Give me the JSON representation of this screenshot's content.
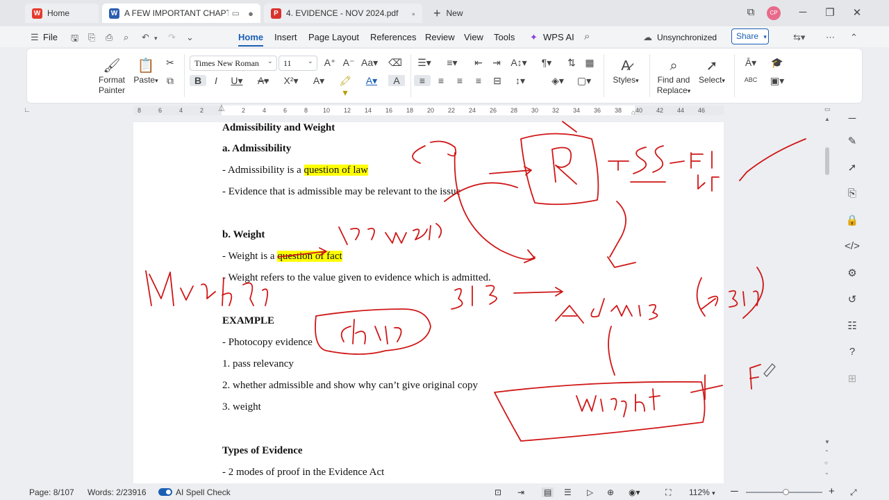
{
  "tabs": [
    {
      "label": "Home",
      "icon": "wps-logo-icon",
      "color": "#e63a2e"
    },
    {
      "label": "A FEW IMPORTANT CHAPTER",
      "icon": "word-doc-icon",
      "color": "#2a5db0"
    },
    {
      "label": "4. EVIDENCE - NOV 2024.pdf",
      "icon": "pdf-icon",
      "color": "#d9322b"
    }
  ],
  "new_tab_label": "New",
  "avatar_initials": "CP",
  "menu": {
    "file": "File",
    "items": [
      "Home",
      "Insert",
      "Page Layout",
      "References",
      "Review",
      "View",
      "Tools"
    ],
    "wps_ai": "WPS AI",
    "sync": "Unsynchronized",
    "share": "Share"
  },
  "ribbon": {
    "format_painter_1": "Format",
    "format_painter_2": "Painter",
    "paste": "Paste",
    "font_name": "Times New Roman",
    "font_size": "11",
    "styles": "Styles",
    "find_1": "Find and",
    "find_2": "Replace",
    "select": "Select"
  },
  "ruler_labels": [
    "8",
    "6",
    "4",
    "2",
    "2",
    "4",
    "6",
    "8",
    "10",
    "12",
    "14",
    "16",
    "18",
    "20",
    "22",
    "24",
    "26",
    "28",
    "30",
    "32",
    "34",
    "36",
    "38",
    "40",
    "42",
    "44",
    "46"
  ],
  "document": {
    "h1": "Admissibility and Weight",
    "a_title": "a. Admissibility",
    "a1_pre": "- Admissibility is a ",
    "a1_hl": "question of law",
    "a2": "- Evidence that is admissible may be relevant to the issue",
    "b_title": "b. Weight",
    "b1_pre": "- Weight is a ",
    "b1_hl": "question of fact",
    "b2": "- Weight refers to the value given to evidence which is admitted.",
    "example": "EXAMPLE",
    "e1": "- Photocopy evidence",
    "e2": "1. pass relevancy",
    "e3": "2. whether admissible and show why can’t give original copy",
    "e4": "3. weight",
    "types": "Types of Evidence",
    "t1": "- 2 modes of proof in the Evidence Act"
  },
  "status": {
    "page": "Page: 8/107",
    "words": "Words: 2/23916",
    "spell": "AI Spell Check",
    "zoom": "112%"
  },
  "colors": {
    "accent": "#1a5fb4",
    "ink": "#d01616",
    "highlight": "#ffff00"
  }
}
